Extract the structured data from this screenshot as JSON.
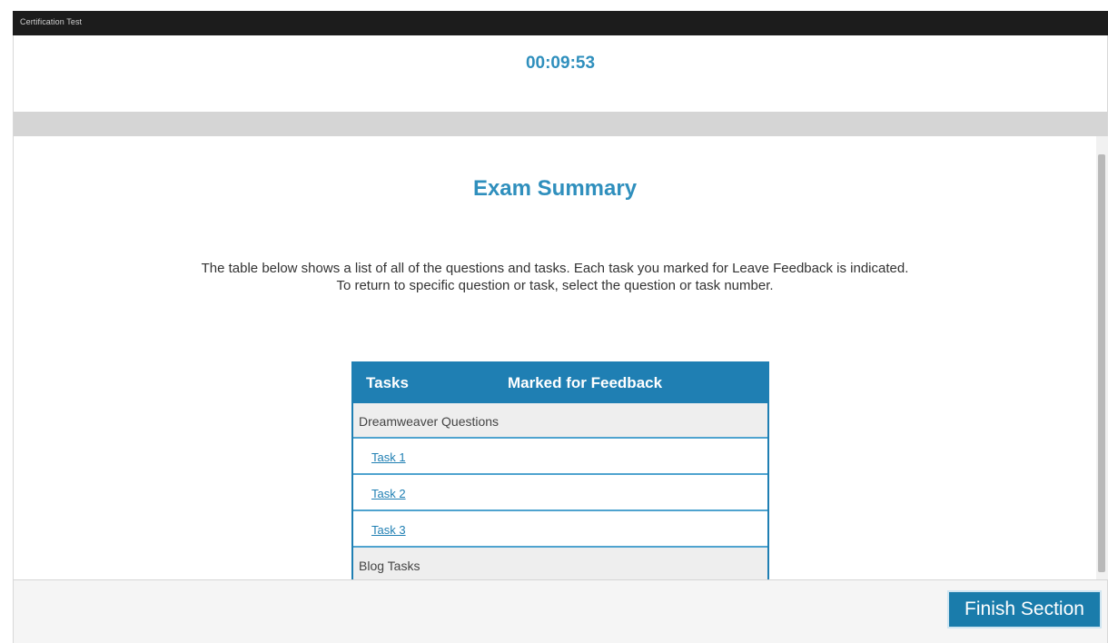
{
  "window": {
    "title": "Certification Test"
  },
  "timer": {
    "value": "00:09:53"
  },
  "summary": {
    "title": "Exam Summary",
    "description": "The table below shows a list of all of the questions and tasks. Each task you marked for Leave Feedback is indicated. To return to specific question or task, select the question or task number."
  },
  "table": {
    "headers": {
      "tasks": "Tasks",
      "marked": "Marked for Feedback"
    },
    "groups": [
      {
        "name": "Dreamweaver Questions",
        "tasks": [
          "Task 1",
          "Task 2",
          "Task 3"
        ]
      },
      {
        "name": "Blog Tasks",
        "tasks": []
      }
    ]
  },
  "footer": {
    "finish_label": "Finish Section"
  }
}
